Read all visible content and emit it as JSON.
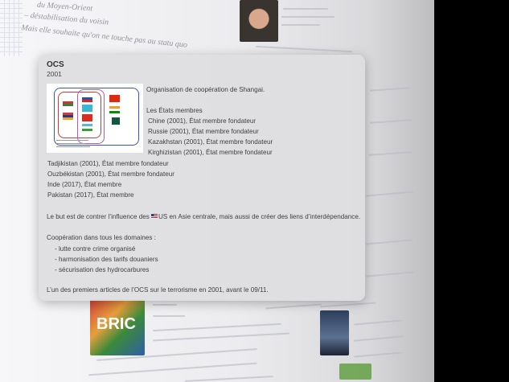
{
  "popover": {
    "title": "OCS",
    "year": "2001",
    "heading": "Organisation de coopération de Shangai.",
    "members_title": "Les États membres",
    "members": [
      "Chine (2001), État membre fondateur",
      "Russie (2001), État membre fondateur",
      "Kazakhstan (2001), État membre fondateur",
      "Kirghizistan (2001), État membre fondateur",
      "Tadjikistan (2001), État membre fondateur",
      "Ouzbékistan (2001), État membre fondateur",
      "Inde (2017), État membre",
      "Pakistan (2017), État membre"
    ],
    "goal_before": "Le but est de contrer l’influence des ",
    "goal_after": "US en Asie centrale, mais aussi de créer des liens d’interdépendance.",
    "coop_title": "Coopération dans tous les domaines :",
    "coop_items": [
      "- lutte contre crime organisé",
      "- harmonisation des tarifs douaniers",
      "- sécurisation des hydrocarbures"
    ],
    "footer": "L’un des premiers articles de l’OCS sur le terrorisme en 2001, avant le 09/11."
  },
  "background": {
    "line_1": "– déstabilisation du voisin",
    "line_2": "Mais elle souhaite qu'on ne touche pas au statu quo",
    "line_3": "du Moyen-Orient",
    "bric_label": "BRIC"
  },
  "colors": {
    "popover_bg": "#dedee0",
    "text": "#3e3e41"
  }
}
